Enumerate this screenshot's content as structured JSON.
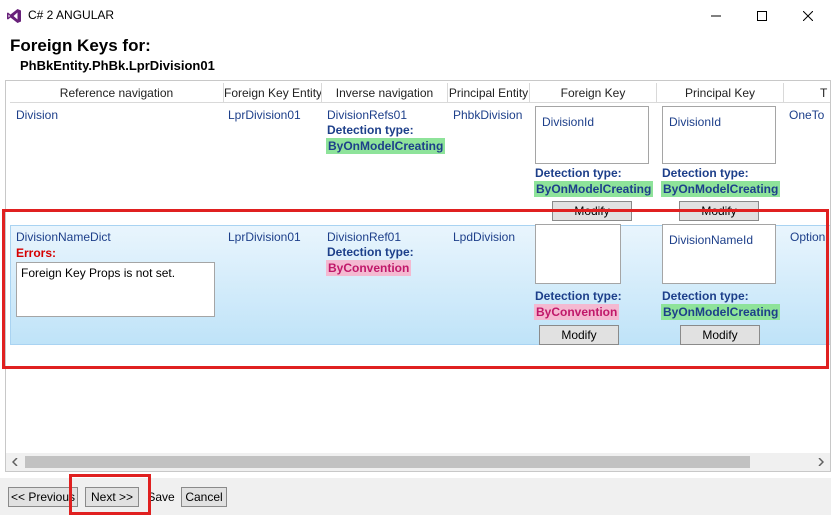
{
  "window": {
    "title": "C# 2 ANGULAR",
    "app_icon": "visual-studio-icon",
    "buttons": [
      "minimize-icon",
      "maximize-icon",
      "close-icon"
    ]
  },
  "page": {
    "heading": "Foreign Keys for:",
    "entity": "PhBkEntity.PhBk.LprDivision01"
  },
  "grid": {
    "columns": [
      "Reference navigation",
      "Foreign Key Entity",
      "Inverse navigation",
      "Principal Entity",
      "Foreign Key",
      "Principal Key",
      "T"
    ],
    "rows": [
      {
        "reference_navigation": "Division",
        "foreign_key_entity": "LprDivision01",
        "inverse_navigation": "DivisionRefs01",
        "inverse_detection_label": "Detection type:",
        "inverse_detection_value": "ByOnModelCreating",
        "principal_entity": "PhbkDivision",
        "foreign_key_item": "DivisionId",
        "foreign_key_detection_label": "Detection type:",
        "foreign_key_detection_value": "ByOnModelCreating",
        "foreign_key_button": "Modify",
        "principal_key_item": "DivisionId",
        "principal_key_detection_label": "Detection type:",
        "principal_key_detection_value": "ByOnModelCreating",
        "principal_key_button": "Modify",
        "type": "OneTo"
      },
      {
        "reference_navigation": "DivisionNameDict",
        "errors_label": "Errors:",
        "error_text": "Foreign Key Props is not set.",
        "foreign_key_entity": "LprDivision01",
        "inverse_navigation": "DivisionRef01",
        "inverse_detection_label": "Detection type:",
        "inverse_detection_value": "ByConvention",
        "principal_entity": "LpdDivision",
        "foreign_key_item": "",
        "foreign_key_detection_label": "Detection type:",
        "foreign_key_detection_value": "ByConvention",
        "foreign_key_button": "Modify",
        "principal_key_item": "DivisionNameId",
        "principal_key_detection_label": "Detection type:",
        "principal_key_detection_value": "ByOnModelCreating",
        "principal_key_button": "Modify",
        "type": "Option"
      }
    ]
  },
  "footer": {
    "previous": "<< Previous",
    "next": "Next >>",
    "save": "Save",
    "cancel": "Cancel"
  },
  "colors": {
    "highlight": "#e02020",
    "detection_green": "#8ee39a",
    "detection_pink": "#f4b9d1",
    "selected_row": "#bfe3f8",
    "link_text": "#1d3f8a"
  }
}
